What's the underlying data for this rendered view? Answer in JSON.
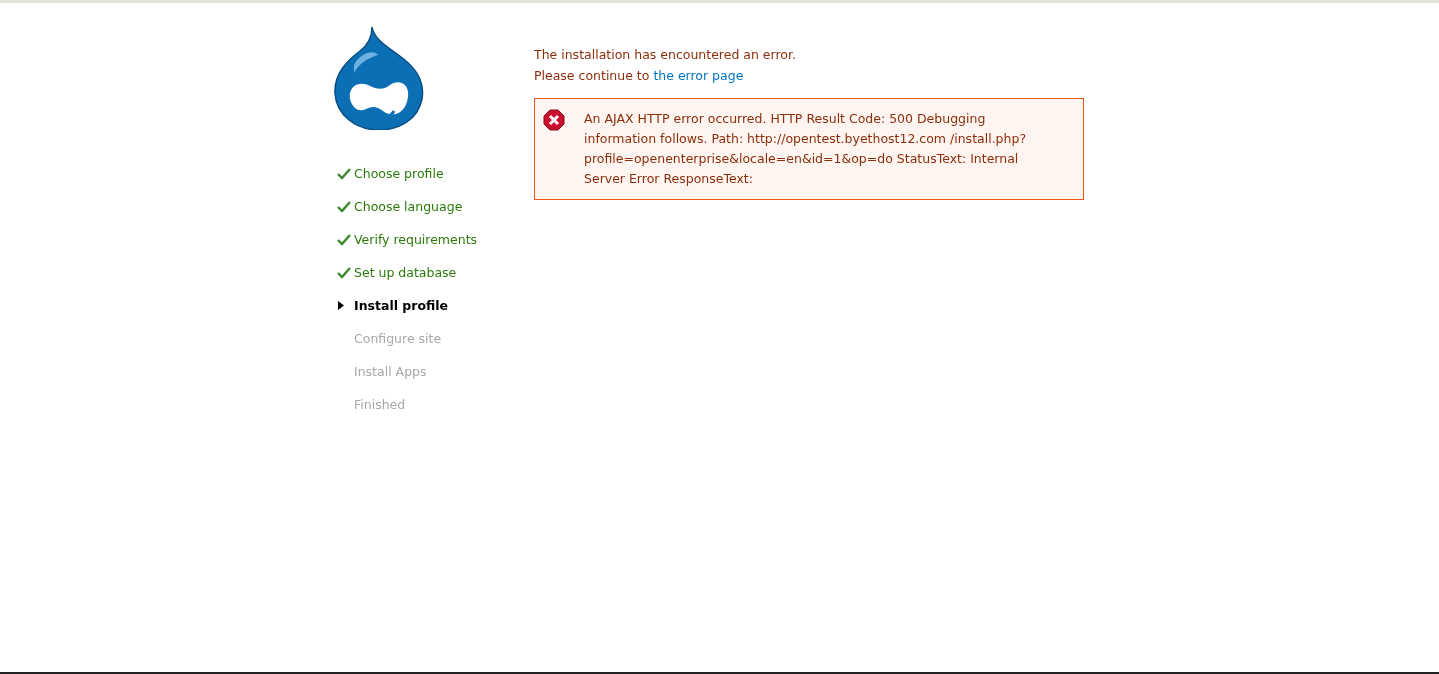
{
  "steps": [
    {
      "label": "Choose profile",
      "done": true,
      "selected": false
    },
    {
      "label": "Choose language",
      "done": true,
      "selected": false
    },
    {
      "label": "Verify requirements",
      "done": true,
      "selected": false
    },
    {
      "label": "Set up database",
      "done": true,
      "selected": false
    },
    {
      "label": "Install profile",
      "done": false,
      "selected": true
    },
    {
      "label": "Configure site",
      "done": false,
      "selected": false
    },
    {
      "label": "Install Apps",
      "done": false,
      "selected": false
    },
    {
      "label": "Finished",
      "done": false,
      "selected": false
    }
  ],
  "intro": {
    "heading": "The installation has encountered an error.",
    "continue_text": "Please continue to",
    "link": "the error page"
  },
  "messages": [
    {
      "kind": "error",
      "text": "An AJAX HTTP error occurred. HTTP Result Code: 500 Debugging information follows. Path: http://opentest.byethost12.com /install.php?profile=openenterprise&locale=en&id=1&op=do StatusText: Internal Server Error ResponseText:"
    }
  ]
}
